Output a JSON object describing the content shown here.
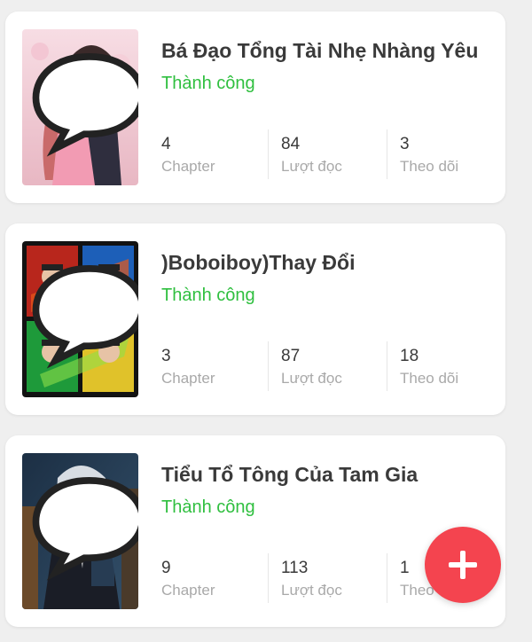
{
  "stories": [
    {
      "title": "Bá Đạo Tổng Tài Nhẹ Nhàng Yêu",
      "status": "Thành công",
      "stats": [
        {
          "value": "4",
          "label": "Chapter"
        },
        {
          "value": "84",
          "label": "Lượt đọc"
        },
        {
          "value": "3",
          "label": "Theo dõi"
        }
      ]
    },
    {
      "title": ")Boboiboy)Thay Đổi",
      "status": "Thành công",
      "stats": [
        {
          "value": "3",
          "label": "Chapter"
        },
        {
          "value": "87",
          "label": "Lượt đọc"
        },
        {
          "value": "18",
          "label": "Theo dõi"
        }
      ]
    },
    {
      "title": "Tiểu Tổ Tông Của Tam Gia",
      "status": "Thành công",
      "stats": [
        {
          "value": "9",
          "label": "Chapter"
        },
        {
          "value": "113",
          "label": "Lượt đọc"
        },
        {
          "value": "1",
          "label": "Theo dõi"
        }
      ]
    }
  ],
  "colors": {
    "status": "#2fbf3f",
    "fab": "#f4444f"
  },
  "icons": {
    "fab": "plus-icon",
    "cover_badge": "chat-bubble-icon"
  }
}
